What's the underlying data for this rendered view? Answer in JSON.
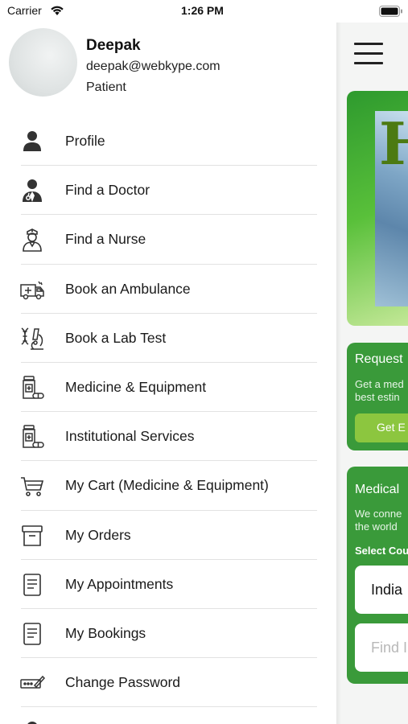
{
  "status_bar": {
    "carrier": "Carrier",
    "time": "1:26 PM"
  },
  "profile": {
    "name": "Deepak",
    "email": "deepak@webkype.com",
    "role": "Patient"
  },
  "menu": [
    {
      "label": "Profile",
      "icon": "person-icon"
    },
    {
      "label": "Find a Doctor",
      "icon": "doctor-icon"
    },
    {
      "label": "Find a Nurse",
      "icon": "nurse-icon"
    },
    {
      "label": "Book an Ambulance",
      "icon": "ambulance-icon"
    },
    {
      "label": "Book a Lab Test",
      "icon": "lab-test-icon"
    },
    {
      "label": "Medicine & Equipment",
      "icon": "medicine-bottle-icon"
    },
    {
      "label": "Institutional Services",
      "icon": "medicine-bottle-icon"
    },
    {
      "label": "My Cart (Medicine & Equipment)",
      "icon": "cart-icon"
    },
    {
      "label": "My Orders",
      "icon": "archive-box-icon"
    },
    {
      "label": "My Appointments",
      "icon": "document-icon"
    },
    {
      "label": "My Bookings",
      "icon": "document-icon"
    },
    {
      "label": "Change Password",
      "icon": "password-icon"
    }
  ],
  "main": {
    "banner_letter": "H",
    "request_card": {
      "title": "Request",
      "text": "Get a med\nbest estin",
      "button": "Get E"
    },
    "medical_card": {
      "title": "Medical",
      "text": "We conne\nthe world",
      "select_label": "Select Cou",
      "country_value": "India",
      "search_placeholder": "Find I"
    }
  },
  "colors": {
    "brand_green": "#3a9a3a",
    "button_green": "#8cc63f",
    "banner_green": "#59c03a"
  }
}
